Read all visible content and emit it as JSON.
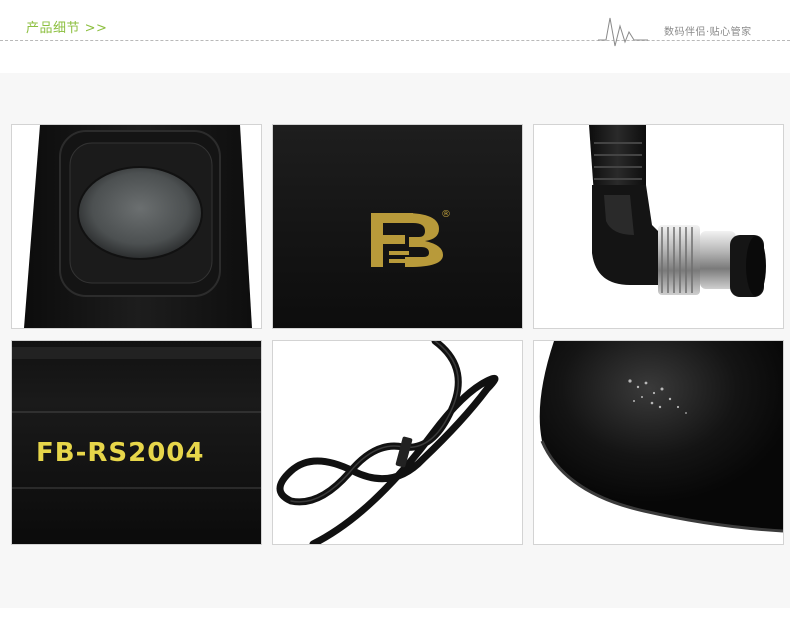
{
  "header": {
    "title": "产品细节 >>",
    "slogan": "数码伴侣·贴心管家"
  },
  "details": {
    "brand_logo": "FB",
    "registered_mark": "®",
    "model_label": "FB-RS2004"
  },
  "colors": {
    "accent": "#8cbf3f",
    "panel_bg": "#f7f7f7",
    "tile_border": "#d3d3d3",
    "logo_gold": "#b89a3a",
    "label_yellow": "#e7d64a"
  }
}
